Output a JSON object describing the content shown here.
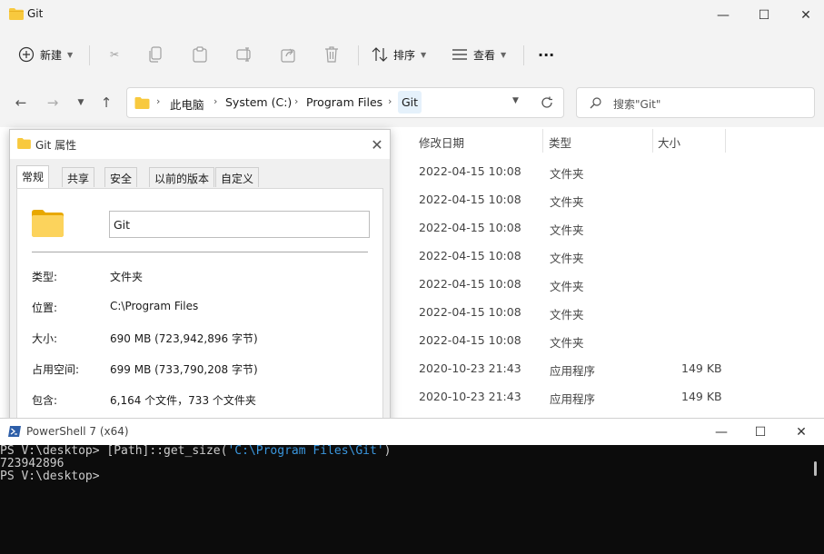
{
  "explorer": {
    "title": "Git",
    "window_buttons": {
      "minimize": "—",
      "maximize": "☐",
      "close": "✕"
    },
    "toolbar": {
      "new_label": "新建",
      "sort_label": "排序",
      "view_label": "查看",
      "more_label": "···"
    },
    "breadcrumb": [
      "此电脑",
      "System (C:)",
      "Program Files",
      "Git"
    ],
    "search_placeholder": "搜索\"Git\"",
    "columns": [
      "修改日期",
      "类型",
      "大小"
    ],
    "rows": [
      {
        "date": "2022-04-15 10:08",
        "type": "文件夹",
        "size": ""
      },
      {
        "date": "2022-04-15 10:08",
        "type": "文件夹",
        "size": ""
      },
      {
        "date": "2022-04-15 10:08",
        "type": "文件夹",
        "size": ""
      },
      {
        "date": "2022-04-15 10:08",
        "type": "文件夹",
        "size": ""
      },
      {
        "date": "2022-04-15 10:08",
        "type": "文件夹",
        "size": ""
      },
      {
        "date": "2022-04-15 10:08",
        "type": "文件夹",
        "size": ""
      },
      {
        "date": "2022-04-15 10:08",
        "type": "文件夹",
        "size": ""
      },
      {
        "date": "2020-10-23 21:43",
        "type": "应用程序",
        "size": "149 KB"
      },
      {
        "date": "2020-10-23 21:43",
        "type": "应用程序",
        "size": "149 KB"
      }
    ]
  },
  "properties": {
    "title": "Git 属性",
    "tabs": [
      "常规",
      "共享",
      "安全",
      "以前的版本",
      "自定义"
    ],
    "name_value": "Git",
    "fields": [
      {
        "label": "类型:",
        "value": "文件夹"
      },
      {
        "label": "位置:",
        "value": "C:\\Program Files"
      },
      {
        "label": "大小:",
        "value": "690 MB (723,942,896 字节)"
      },
      {
        "label": "占用空间:",
        "value": "699 MB (733,790,208 字节)"
      },
      {
        "label": "包含:",
        "value": "6,164 个文件，733 个文件夹"
      }
    ]
  },
  "powershell": {
    "title": "PowerShell 7 (x64)",
    "line1_prompt": "PS V:\\desktop> ",
    "line1_cmd": "[Path]::get_size(",
    "line1_str": "'C:\\Program Files\\Git'",
    "line1_end": ")",
    "line2": "723942896",
    "line3": "PS V:\\desktop>"
  },
  "colors": {
    "folder_yellow": "#f8c93e",
    "ps_background": "#0c0c0c",
    "ps_string": "#3a96dd",
    "ps_icon": "#2d5ea8"
  }
}
